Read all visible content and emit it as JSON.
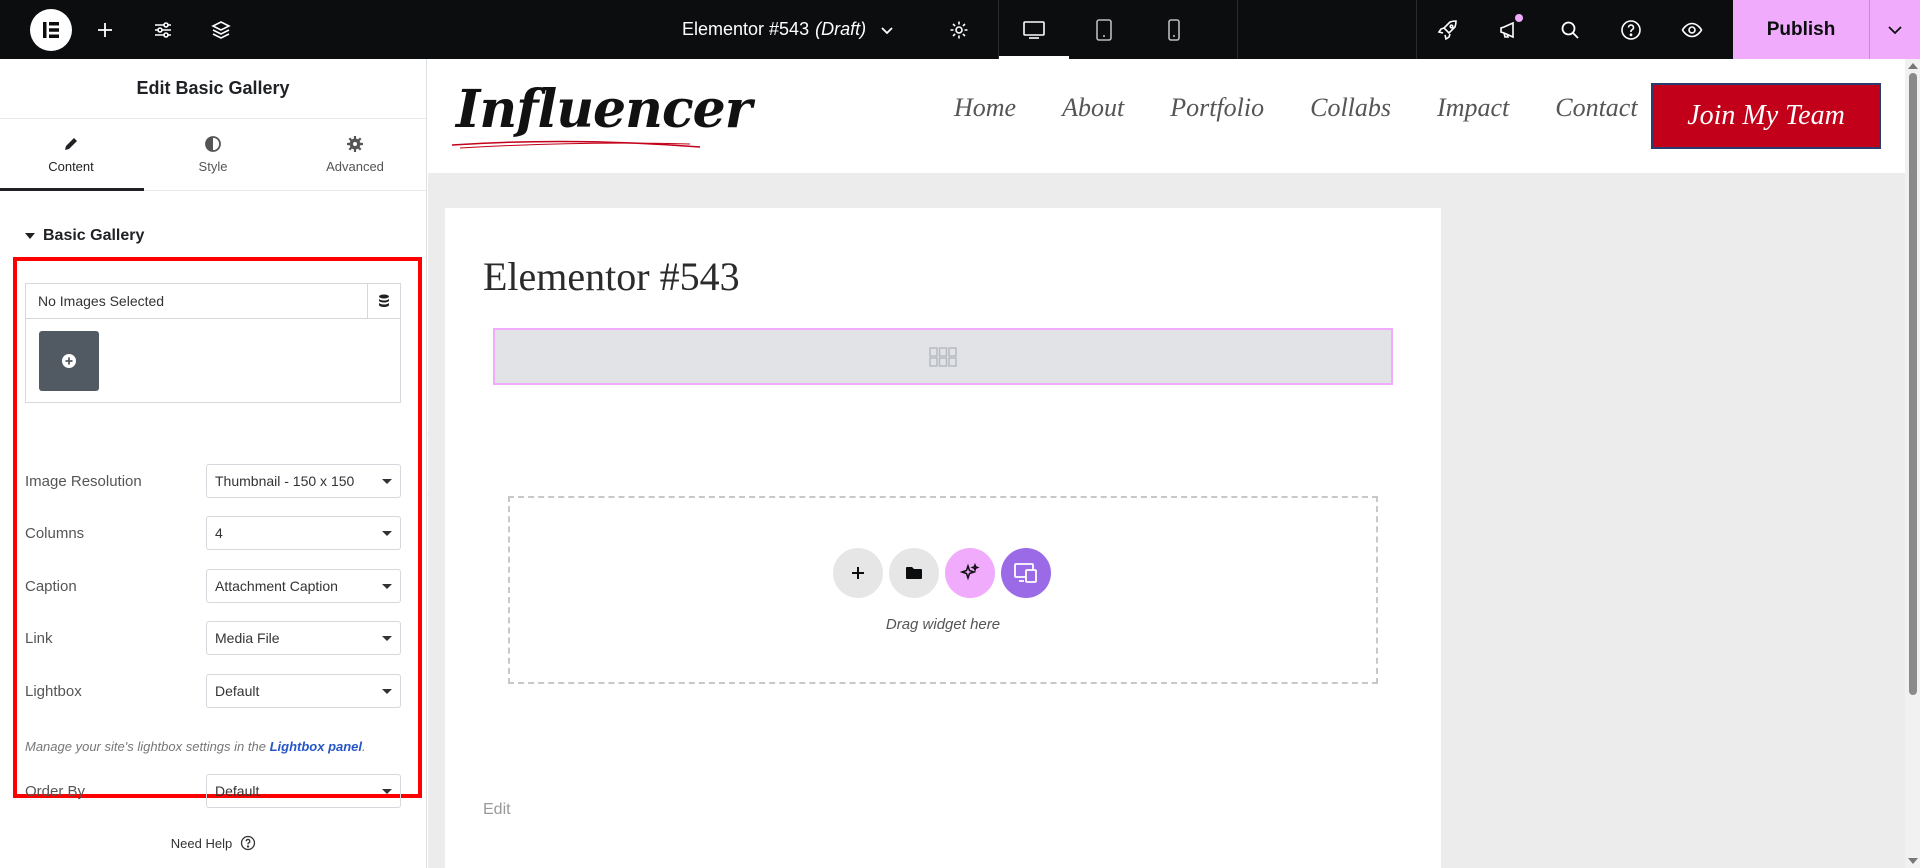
{
  "topbar": {
    "document_title": "Elementor #543",
    "document_status": "(Draft)",
    "publish_label": "Publish",
    "icons": [
      "elementor-logo-icon",
      "plus-icon",
      "sliders-icon",
      "layers-icon",
      "chevron-down-icon",
      "gear-icon",
      "desktop-icon",
      "tablet-icon",
      "mobile-icon",
      "rocket-icon",
      "megaphone-icon",
      "search-icon",
      "help-icon",
      "eye-icon",
      "chevron-down-icon"
    ],
    "accent_color": "#f0abfc"
  },
  "panel": {
    "title": "Edit Basic Gallery",
    "tabs": [
      {
        "label": "Content",
        "icon": "pencil-icon",
        "active": true
      },
      {
        "label": "Style",
        "icon": "half-circle-icon",
        "active": false
      },
      {
        "label": "Advanced",
        "icon": "gear-icon",
        "active": false
      }
    ],
    "section_title": "Basic Gallery",
    "gallery_label": "No Images Selected",
    "controls": [
      {
        "label": "Image Resolution",
        "value": "Thumbnail - 150 x 150"
      },
      {
        "label": "Columns",
        "value": "4"
      },
      {
        "label": "Caption",
        "value": "Attachment Caption"
      },
      {
        "label": "Link",
        "value": "Media File"
      },
      {
        "label": "Lightbox",
        "value": "Default"
      },
      {
        "label": "Order By",
        "value": "Default"
      }
    ],
    "lightbox_note": "Manage your site's lightbox settings in the",
    "lightbox_link": "Lightbox panel",
    "lightbox_note_end": ".",
    "need_help": "Need Help"
  },
  "canvas": {
    "logo_text": "Influencer",
    "nav": [
      "Home",
      "About",
      "Portfolio",
      "Collabs",
      "Impact",
      "Contact"
    ],
    "cta_label": "Join My Team",
    "cta_color": "#c2001a",
    "page_title": "Elementor #543",
    "drag_text": "Drag widget here",
    "edit_label": "Edit"
  }
}
